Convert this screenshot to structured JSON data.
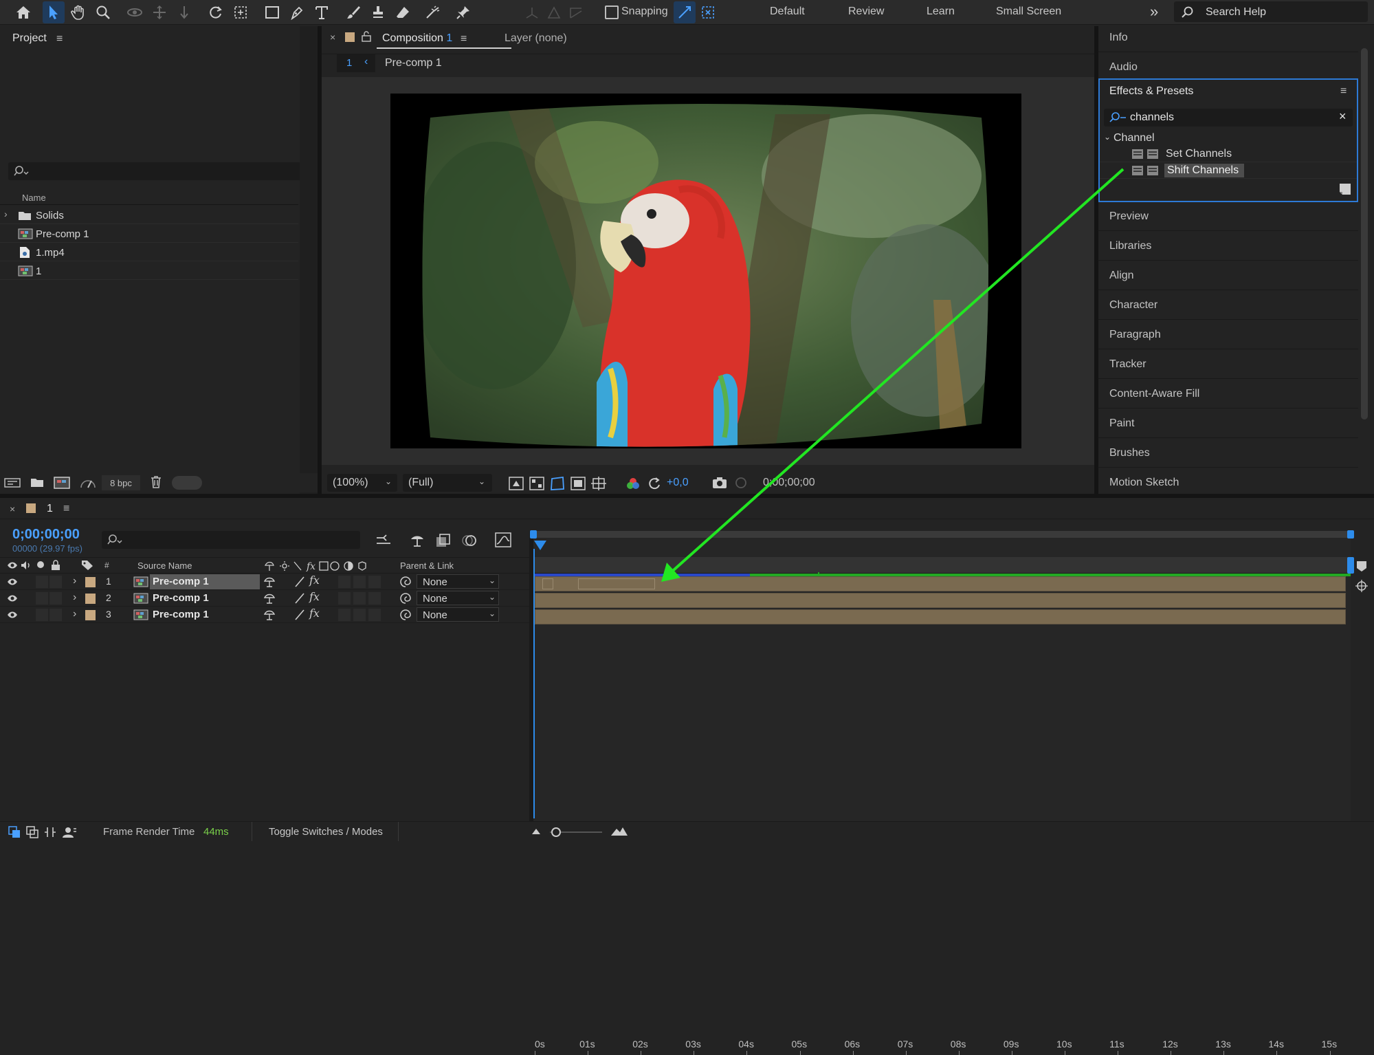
{
  "toolbar": {
    "snapping_label": "Snapping",
    "workspaces": [
      "Default",
      "Review",
      "Learn",
      "Small Screen"
    ],
    "search_help_label": "Search Help"
  },
  "project": {
    "title": "Project",
    "column_name": "Name",
    "items": [
      {
        "label": "Solids",
        "icon": "folder-icon"
      },
      {
        "label": "Pre-comp 1",
        "icon": "composition-icon"
      },
      {
        "label": "1.mp4",
        "icon": "footage-icon"
      },
      {
        "label": "1",
        "icon": "composition-icon"
      }
    ],
    "bpc_label": "8 bpc"
  },
  "composition": {
    "tab_label": "Composition",
    "tab_number": "1",
    "layer_tab_label": "Layer (none)",
    "breadcrumb_number": "1",
    "breadcrumb_label": "Pre-comp 1",
    "zoom_value": "(100%)",
    "resolution_value": "(Full)",
    "exposure_value": "+0,0",
    "timecode": "0;00;00;00"
  },
  "right_panel": {
    "top_items": [
      "Info",
      "Audio"
    ],
    "effects_title": "Effects & Presets",
    "search_value": "channels",
    "category_label": "Channel",
    "effects": [
      "Set Channels",
      "Shift Channels"
    ],
    "bottom_items": [
      "Preview",
      "Libraries",
      "Align",
      "Character",
      "Paragraph",
      "Tracker",
      "Content-Aware Fill",
      "Paint",
      "Brushes",
      "Motion Sketch"
    ]
  },
  "timeline": {
    "comp_number": "1",
    "timecode": "0;00;00;00",
    "frame_info": "00000 (29.97 fps)",
    "col_number": "#",
    "col_source": "Source Name",
    "col_parent": "Parent & Link",
    "ruler": [
      "0s",
      "01s",
      "02s",
      "03s",
      "04s",
      "05s",
      "06s",
      "07s",
      "08s",
      "09s",
      "10s",
      "11s",
      "12s",
      "13s",
      "14s",
      "15s"
    ],
    "layers": [
      {
        "num": "1",
        "name": "Pre-comp 1",
        "parent": "None",
        "selected": true
      },
      {
        "num": "2",
        "name": "Pre-comp 1",
        "parent": "None",
        "selected": false
      },
      {
        "num": "3",
        "name": "Pre-comp 1",
        "parent": "None",
        "selected": false
      }
    ]
  },
  "status": {
    "frame_render_label": "Frame Render Time",
    "frame_render_value": "44ms",
    "toggle_label": "Toggle Switches / Modes"
  },
  "colors": {
    "accent": "#2d8ceb",
    "arrow": "#22e622",
    "bar": "#7a6a50",
    "label_tan": "#c8a880"
  }
}
